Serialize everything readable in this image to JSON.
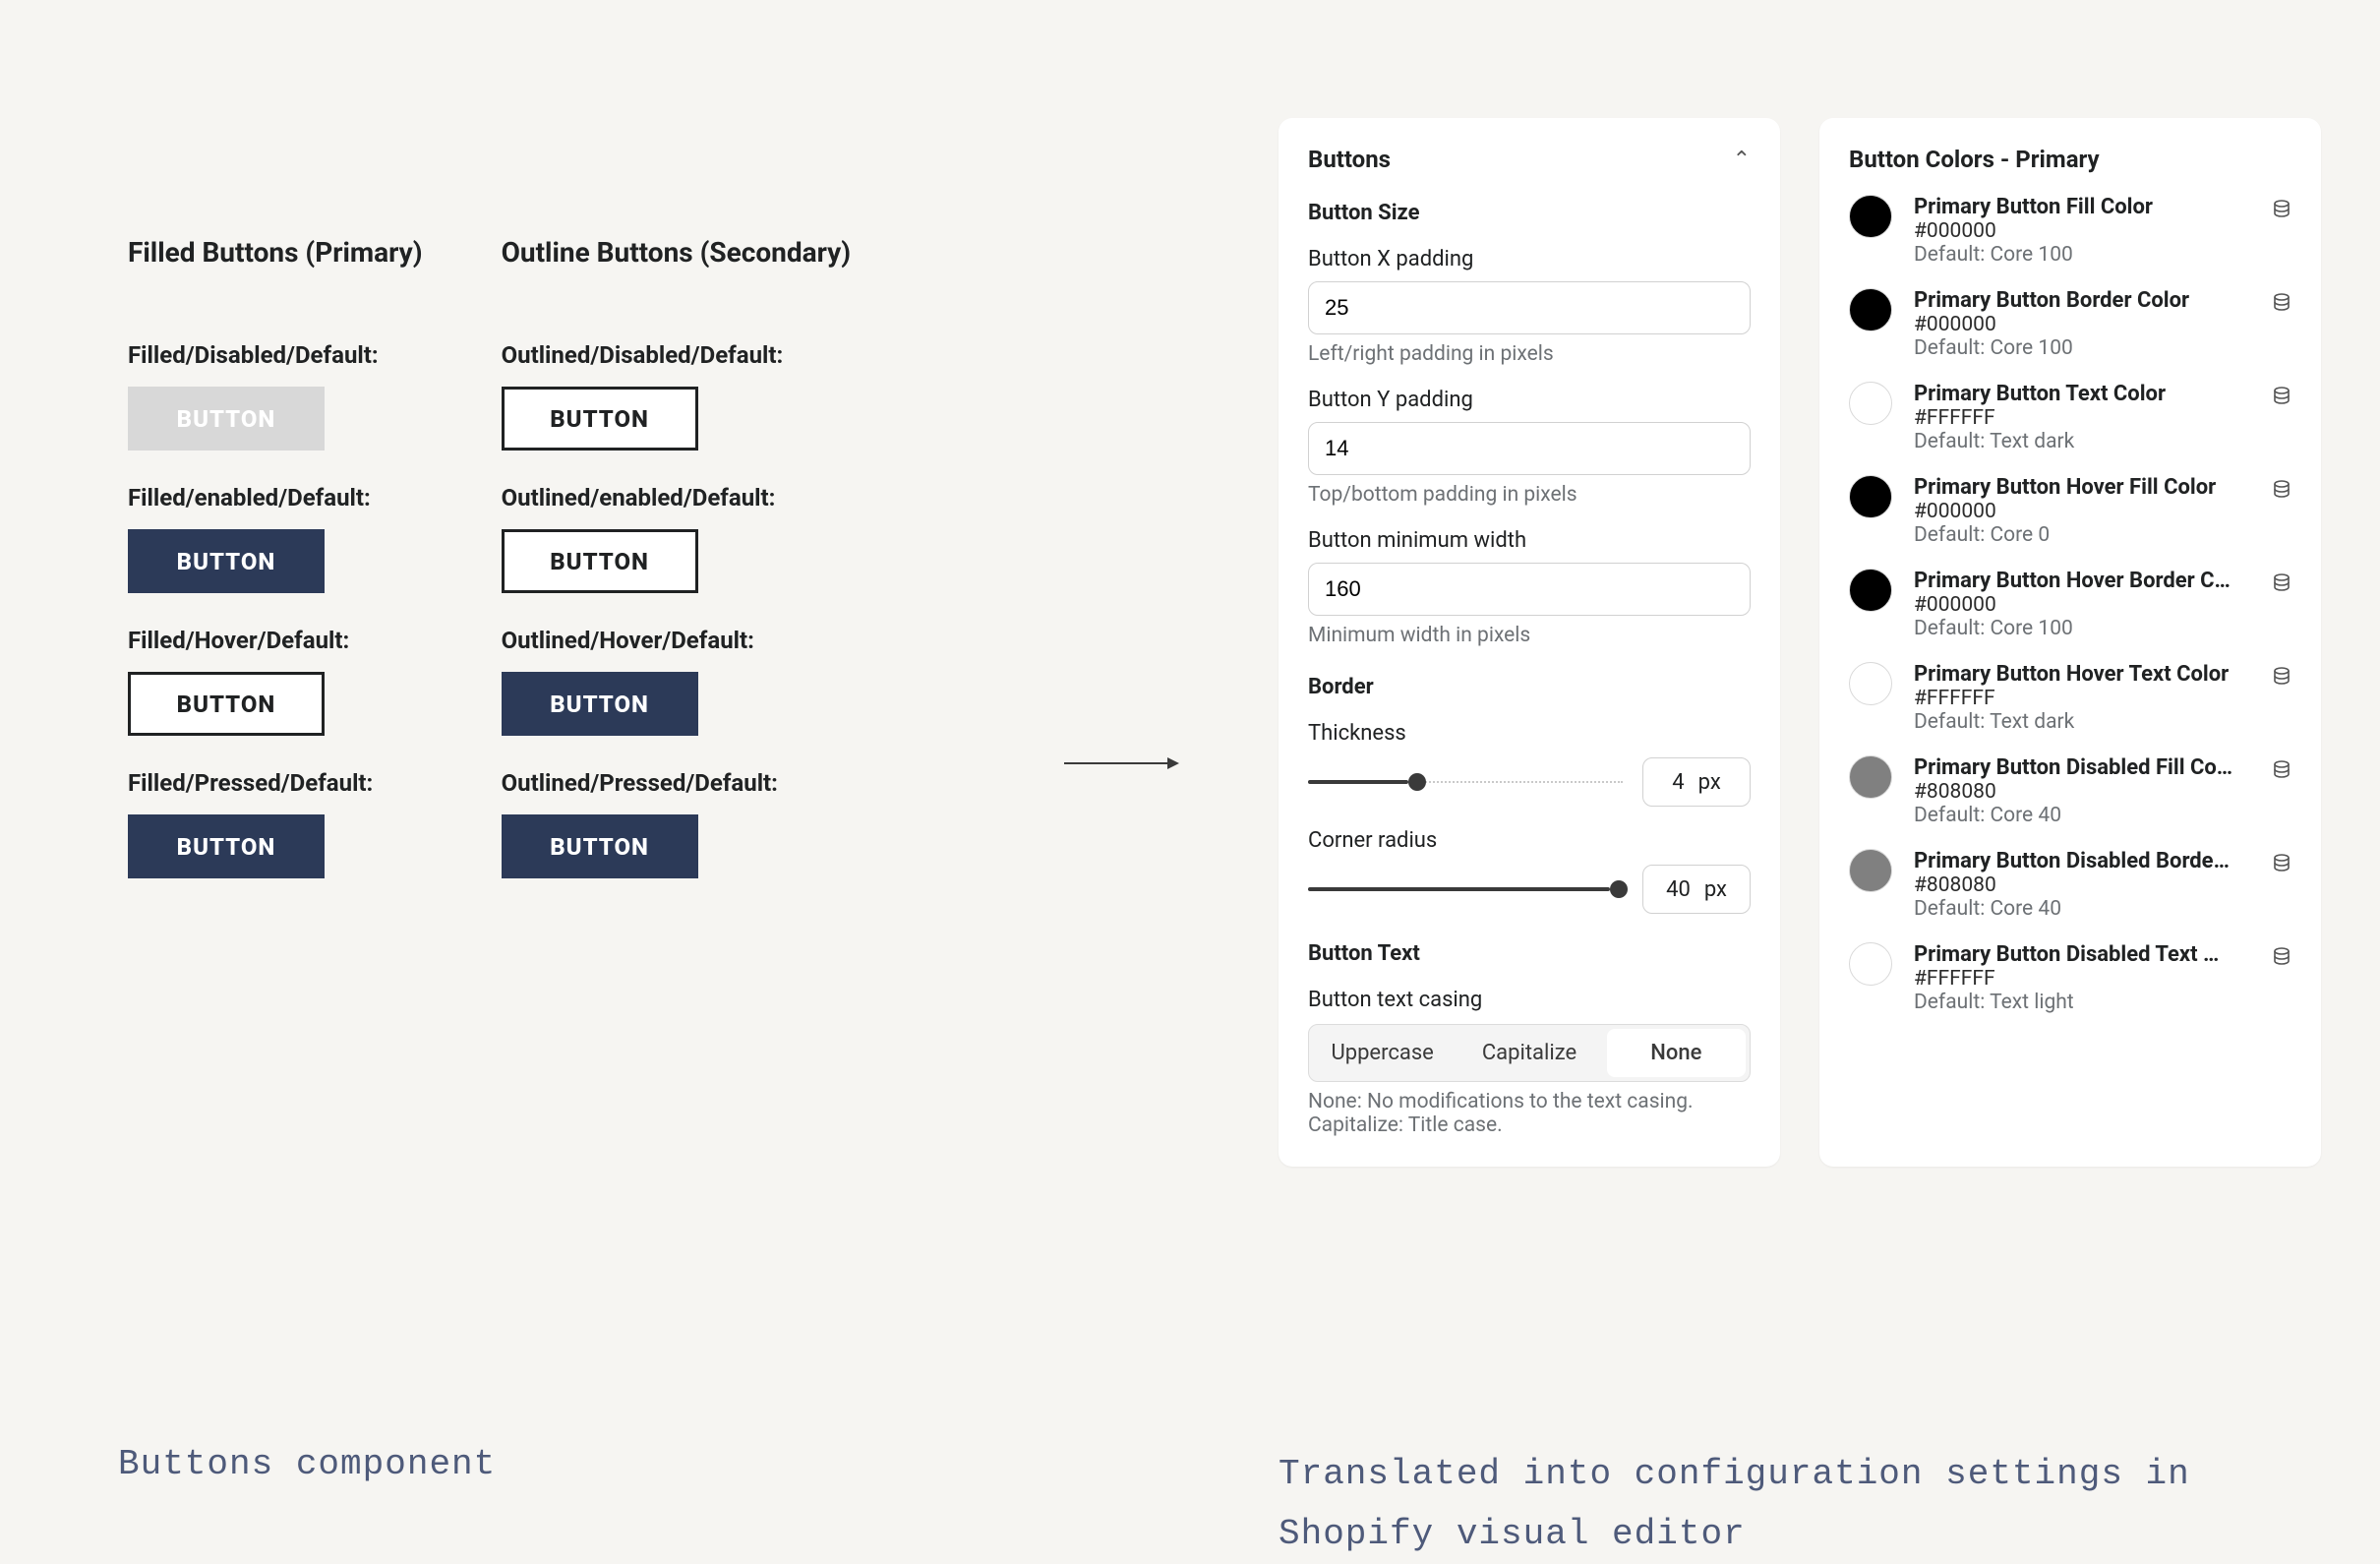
{
  "left": {
    "filled_title": "Filled Buttons (Primary)",
    "outline_title": "Outline Buttons (Secondary)",
    "button_text": "BUTTON",
    "labels": {
      "filled_disabled": "Filled/Disabled/Default:",
      "filled_enabled": "Filled/enabled/Default:",
      "filled_hover": "Filled/Hover/Default:",
      "filled_pressed": "Filled/Pressed/Default:",
      "out_disabled": "Outlined/Disabled/Default:",
      "out_enabled": "Outlined/enabled/Default:",
      "out_hover": "Outlined/Hover/Default:",
      "out_pressed": "Outlined/Pressed/Default:"
    }
  },
  "panel1": {
    "title": "Buttons",
    "sections": {
      "size_header": "Button Size",
      "x_padding_label": "Button X padding",
      "x_padding_value": "25",
      "x_padding_help": "Left/right padding in pixels",
      "y_padding_label": "Button Y padding",
      "y_padding_value": "14",
      "y_padding_help": "Top/bottom padding in pixels",
      "min_width_label": "Button minimum width",
      "min_width_value": "160",
      "min_width_help": "Minimum width in pixels",
      "border_header": "Border",
      "thickness_label": "Thickness",
      "thickness_value": "4",
      "radius_label": "Corner radius",
      "radius_value": "40",
      "unit": "px",
      "text_header": "Button Text",
      "casing_label": "Button text casing",
      "casing_options": [
        "Uppercase",
        "Capitalize",
        "None"
      ],
      "casing_selected": "None",
      "casing_help": "None: No modifications to the text casing. Capitalize: Title case."
    }
  },
  "panel2": {
    "title": "Button Colors - Primary",
    "rows": [
      {
        "name": "Primary Button Fill Color",
        "hex": "#000000",
        "default": "Default: Core 100",
        "swatch": "black"
      },
      {
        "name": "Primary Button Border Color",
        "hex": "#000000",
        "default": "Default: Core 100",
        "swatch": "black"
      },
      {
        "name": "Primary Button Text Color",
        "hex": "#FFFFFF",
        "default": "Default: Text dark",
        "swatch": "white"
      },
      {
        "name": "Primary Button Hover Fill Color",
        "hex": "#000000",
        "default": "Default: Core 0",
        "swatch": "black"
      },
      {
        "name": "Primary Button Hover Border C…",
        "hex": "#000000",
        "default": "Default: Core 100",
        "swatch": "black"
      },
      {
        "name": "Primary Button Hover Text Color",
        "hex": "#FFFFFF",
        "default": "Default: Text dark",
        "swatch": "white"
      },
      {
        "name": "Primary Button Disabled Fill Co…",
        "hex": "#808080",
        "default": "Default: Core 40",
        "swatch": "gray"
      },
      {
        "name": "Primary Button Disabled Borde…",
        "hex": "#808080",
        "default": "Default: Core 40",
        "swatch": "gray"
      },
      {
        "name": "Primary Button Disabled Text …",
        "hex": "#FFFFFF",
        "default": "Default: Text light",
        "swatch": "white"
      }
    ]
  },
  "captions": {
    "left": "Buttons component",
    "right": "Translated into configuration settings in Shopify visual editor"
  }
}
